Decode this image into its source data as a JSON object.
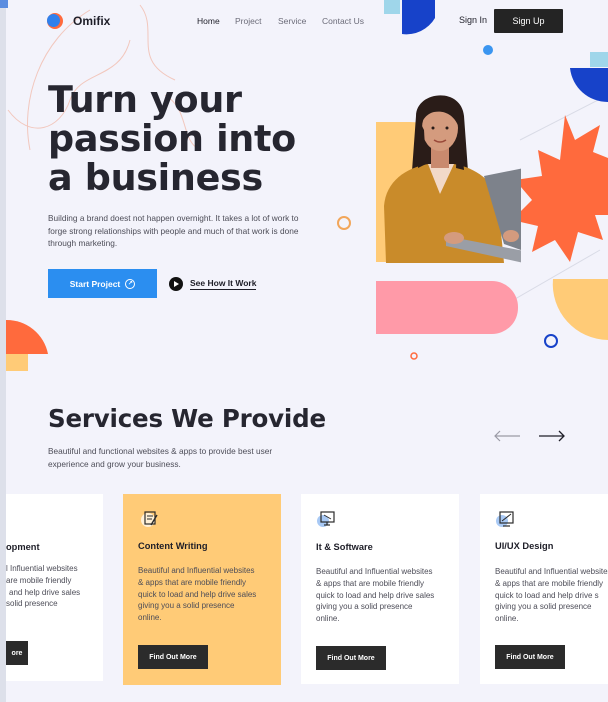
{
  "brand": {
    "name": "Omifix"
  },
  "nav": {
    "items": [
      {
        "label": "Home",
        "active": true
      },
      {
        "label": "Project",
        "active": false
      },
      {
        "label": "Service",
        "active": false
      },
      {
        "label": "Contact Us",
        "active": false
      }
    ]
  },
  "auth": {
    "signin_label": "Sign In",
    "signup_label": "Sign Up"
  },
  "hero": {
    "title_line1": "Turn your",
    "title_line2": "passion into",
    "title_line3": "a business",
    "subtitle": "Building a brand doest not happen overnight. It takes a lot of work to forge strong relationships with people and much of that work is done through marketing.",
    "primary_cta": "Start Project",
    "secondary_cta": "See How It Work"
  },
  "services": {
    "title": "Services We Provide",
    "subtitle": "Beautiful and functional websites & apps to provide best user experience and grow your business.",
    "cards": [
      {
        "title": "opment",
        "desc_lines": [
          "l Influential websites",
          "are mobile friendly",
          "and help drive sales",
          "solid presence"
        ],
        "button": "ore",
        "icon": "code-icon"
      },
      {
        "title": "Content Writing",
        "desc_lines": [
          "Beautiful and Influential websites",
          "& apps that are mobile friendly",
          "quick to load and help drive sales",
          "giving you a solid presence",
          "online."
        ],
        "button": "Find Out More",
        "icon": "pencil-note-icon"
      },
      {
        "title": "It & Software",
        "desc_lines": [
          "Beautiful and Influential websites",
          "& apps that are mobile friendly",
          "quick to load and help drive sales",
          "giving you a solid presence",
          "online."
        ],
        "button": "Find Out More",
        "icon": "monitor-icon"
      },
      {
        "title": "UI/UX Design",
        "desc_lines": [
          "Beautiful and Influential websites",
          "& apps that are mobile friendly",
          "quick to load and help drive s",
          "giving you a solid presence",
          "online."
        ],
        "button": "Find Out More",
        "icon": "design-tablet-icon"
      }
    ]
  },
  "colors": {
    "background": "#f3f3fb",
    "primary_blue": "#2b8ef0",
    "accent_orange": "#ff6a3d",
    "accent_yellow": "#ffcb77",
    "accent_pink": "#ff9aa8",
    "accent_navy": "#1742c9",
    "dark": "#242424"
  }
}
